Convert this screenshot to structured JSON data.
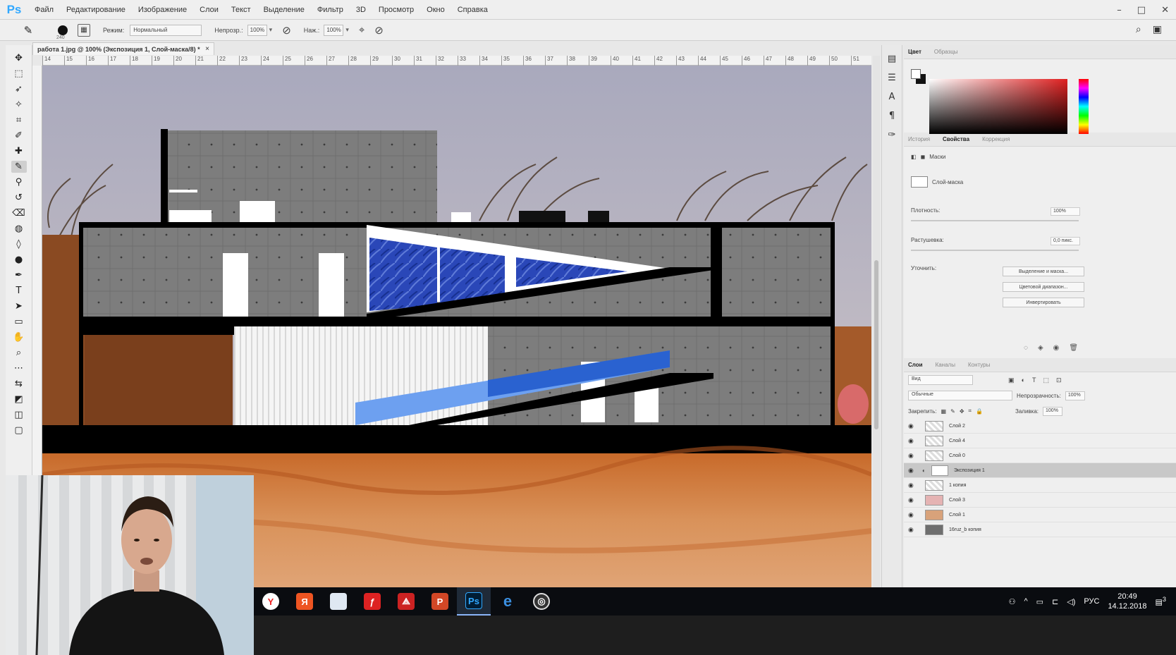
{
  "app": {
    "logo": "Ps",
    "menu": [
      "Файл",
      "Редактирование",
      "Изображение",
      "Слои",
      "Текст",
      "Выделение",
      "Фильтр",
      "3D",
      "Просмотр",
      "Окно",
      "Справка"
    ],
    "window_controls": [
      "–",
      "□",
      "✕"
    ]
  },
  "options": {
    "brush_size": "240",
    "mode_label": "Режим:",
    "mode_value": "Нормальный",
    "opacity_label": "Непрозр.:",
    "opacity_value": "100%",
    "flow_label": "Наж.:",
    "flow_value": "100%"
  },
  "document": {
    "tab_title": "работа 1.jpg @ 100% (Экспозиция 1, Слой-маска/8) *",
    "close": "×",
    "ruler_marks": [
      "14",
      "15",
      "16",
      "17",
      "18",
      "19",
      "20",
      "21",
      "22",
      "23",
      "24",
      "25",
      "26",
      "27",
      "28",
      "29",
      "30",
      "31",
      "32",
      "33",
      "34",
      "35",
      "36",
      "37",
      "38",
      "39",
      "40",
      "41",
      "42",
      "43",
      "44",
      "45",
      "46",
      "47",
      "48",
      "49",
      "50",
      "51"
    ]
  },
  "color_panel": {
    "tabs": [
      "Цвет",
      "Образцы"
    ],
    "accent": "#e02020"
  },
  "properties_panel": {
    "tabs": [
      "История",
      "Свойства",
      "Коррекция"
    ],
    "masks_label": "Маски",
    "layer_mask_label": "Слой-маска",
    "density_label": "Плотность:",
    "density_value": "100%",
    "feather_label": "Растушевка:",
    "feather_value": "0,0 пикс.",
    "refine_label": "Уточнить:",
    "buttons": [
      "Выделение и маска...",
      "Цветовой диапазон...",
      "Инвертировать"
    ]
  },
  "layers_panel": {
    "tabs": [
      "Слои",
      "Каналы",
      "Контуры"
    ],
    "filter_value": "Вид",
    "blend_value": "Обычные",
    "opacity_label": "Непрозрачность:",
    "opacity_value": "100%",
    "lock_label": "Закрепить:",
    "fill_label": "Заливка:",
    "fill_value": "100%",
    "layers": [
      {
        "name": "Слой 2"
      },
      {
        "name": "Слой 4"
      },
      {
        "name": "Слой 0"
      },
      {
        "name": "Экспозиция 1"
      },
      {
        "name": "1 копия"
      },
      {
        "name": "Слой 3"
      },
      {
        "name": "Слой 1"
      },
      {
        "name": "16ruz_b копия"
      }
    ]
  },
  "taskbar": {
    "apps": [
      "Yandex",
      "Я",
      "Files",
      "Flash",
      "Acrobat",
      "PowerPoint",
      "Ps",
      "Edge",
      "Chrome"
    ],
    "lang": "РУС",
    "time": "20:49",
    "date": "14.12.2018",
    "notif": "3"
  }
}
